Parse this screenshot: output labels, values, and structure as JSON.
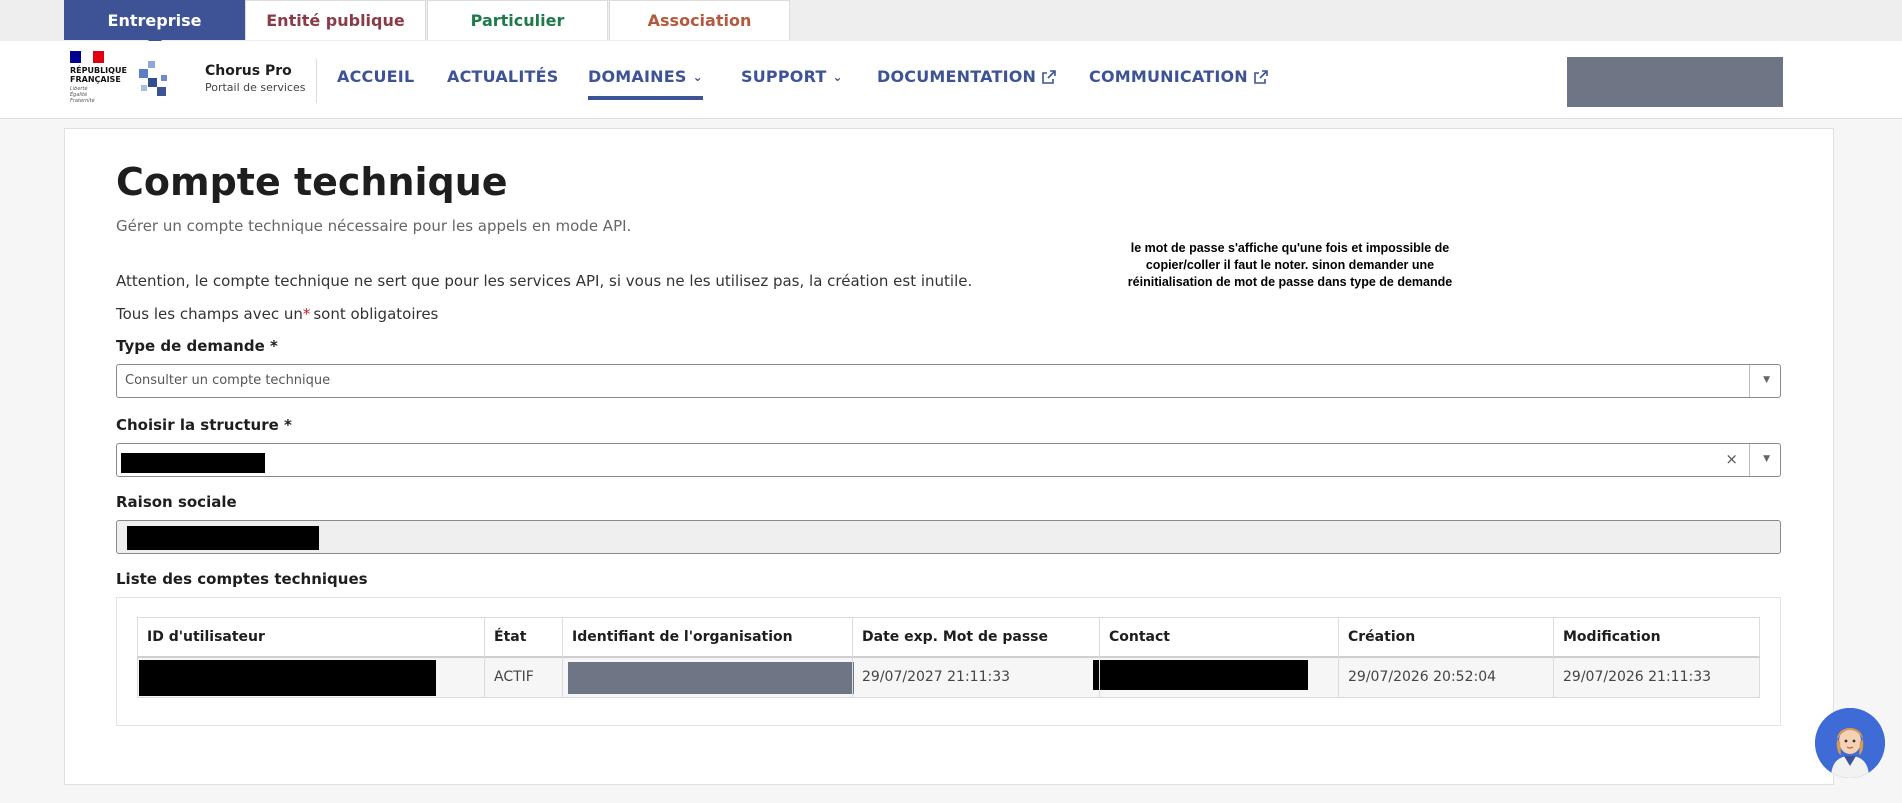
{
  "audience_tabs": [
    {
      "label": "Entreprise",
      "active": true,
      "color": "#ffffff"
    },
    {
      "label": "Entité publique",
      "active": false,
      "color": "#8a3a48"
    },
    {
      "label": "Particulier",
      "active": false,
      "color": "#1f7a4a"
    },
    {
      "label": "Association",
      "active": false,
      "color": "#b35a3e"
    }
  ],
  "brand": {
    "republic_line1": "RÉPUBLIQUE",
    "republic_line2": "FRANÇAISE",
    "motto": [
      "Liberté",
      "Égalité",
      "Fraternité"
    ],
    "name": "Chorus Pro",
    "subtitle": "Portail de services"
  },
  "nav": [
    {
      "label": "ACCUEIL",
      "icon": ""
    },
    {
      "label": "ACTUALITÉS",
      "icon": ""
    },
    {
      "label": "DOMAINES",
      "icon": "chevron-down-icon",
      "active": true
    },
    {
      "label": "SUPPORT",
      "icon": "chevron-down-icon"
    },
    {
      "label": "DOCUMENTATION",
      "icon": "external-link-icon"
    },
    {
      "label": "COMMUNICATION",
      "icon": "external-link-icon"
    }
  ],
  "page": {
    "title": "Compte technique",
    "subtitle": "Gérer un compte technique nécessaire pour les appels en mode API.",
    "attention": "Attention, le compte technique ne sert que pour les services API, si vous ne les utilisez pas, la création est inutile.",
    "required_prefix": "Tous les champs avec un",
    "required_star": "*",
    "required_suffix": "sont obligatoires"
  },
  "overlay_note": [
    "le mot de passe s'affiche qu'une fois et impossible de",
    "copier/coller il faut le noter. sinon demander une",
    "réinitialisation de mot de passe  dans type de demande"
  ],
  "form": {
    "type_label": "Type de demande *",
    "type_value": "Consulter un compte technique",
    "structure_label": "Choisir la structure *",
    "clear_symbol": "×",
    "raison_label": "Raison sociale",
    "arrow_symbol": "▼"
  },
  "table": {
    "title": "Liste des comptes techniques",
    "headers": [
      "ID d'utilisateur",
      "État",
      "Identifiant de l'organisation",
      "Date exp. Mot de passe",
      "Contact",
      "Création",
      "Modification"
    ],
    "rows": [
      {
        "etat": "ACTIF",
        "date_exp": "29/07/2027 21:11:33",
        "creation": "29/07/2026 20:52:04",
        "modification": "29/07/2026 21:11:33"
      }
    ]
  },
  "colors": {
    "primary": "#3e5396",
    "required": "#c9191e",
    "redacted_grey": "#6e7585"
  }
}
